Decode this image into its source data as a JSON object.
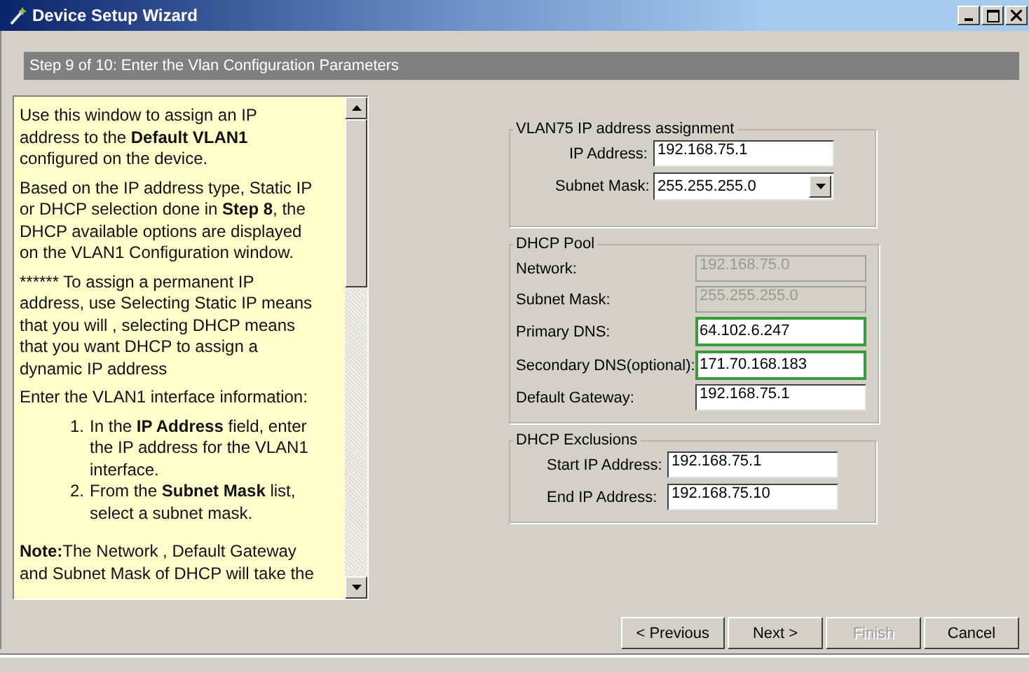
{
  "window": {
    "title": "Device Setup Wizard"
  },
  "step_header": "Step 9 of 10: Enter the Vlan Configuration Parameters",
  "help": [
    {
      "kind": "paragraph",
      "text": "Use this window to assign an IP address to the **Default VLAN1** configured on the device."
    },
    {
      "kind": "paragraph",
      "text": "Based on the IP address type, Static IP or DHCP selection done in **Step 8**, the DHCP available options are displayed on the VLAN1 Configuration window."
    },
    {
      "kind": "plain",
      "text": "****** To assign a permanent IP address, use Selecting Static IP means that you will , selecting DHCP means that you want DHCP to assign a dynamic IP address"
    },
    {
      "kind": "paragraph",
      "text": "Enter the VLAN1 interface information:"
    },
    {
      "kind": "list",
      "items": [
        {
          "number": "1.",
          "text": "In the **IP Address** field, enter the IP address for the VLAN1 interface."
        },
        {
          "number": "2.",
          "text": "From the **Subnet Mask** list, select a subnet mask."
        }
      ]
    },
    {
      "kind": "paragraph",
      "text": "**Note:**The Network , Default Gateway and Subnet Mask of DHCP will take the"
    }
  ],
  "groups": [
    {
      "title": "VLAN75 IP address assignment",
      "fields": [
        {
          "label": "IP Address:",
          "value": "192.168.75.1",
          "kind": "text",
          "disabled": false,
          "focused": false
        },
        {
          "label": "Subnet Mask:",
          "value": "255.255.255.0",
          "kind": "dropdown"
        }
      ]
    },
    {
      "title": "DHCP Pool",
      "fields": [
        {
          "label": "Network:",
          "value": "192.168.75.0",
          "kind": "text",
          "disabled": true,
          "focused": false
        },
        {
          "label": "Subnet Mask:",
          "value": "255.255.255.0",
          "kind": "text",
          "disabled": true,
          "focused": false
        },
        {
          "label": "Primary DNS:",
          "value": "64.102.6.247",
          "kind": "text",
          "disabled": false,
          "focused": true
        },
        {
          "label": "Secondary DNS(optional):",
          "value": "171.70.168.183",
          "kind": "text",
          "disabled": false,
          "focused": true
        },
        {
          "label": "Default Gateway:",
          "value": "192.168.75.1",
          "kind": "text",
          "disabled": false,
          "focused": false
        }
      ]
    },
    {
      "title": "DHCP Exclusions",
      "fields": [
        {
          "label": "Start IP Address:",
          "value": "192.168.75.1",
          "kind": "text",
          "disabled": false,
          "focused": false
        },
        {
          "label": "End IP Address:",
          "value": "192.168.75.10",
          "kind": "text",
          "disabled": false,
          "focused": false
        }
      ]
    }
  ],
  "buttons": [
    {
      "label": "< Previous",
      "disabled": false
    },
    {
      "label": "Next >",
      "disabled": false
    },
    {
      "label": "Finish",
      "disabled": true
    },
    {
      "label": "Cancel",
      "disabled": false
    }
  ]
}
